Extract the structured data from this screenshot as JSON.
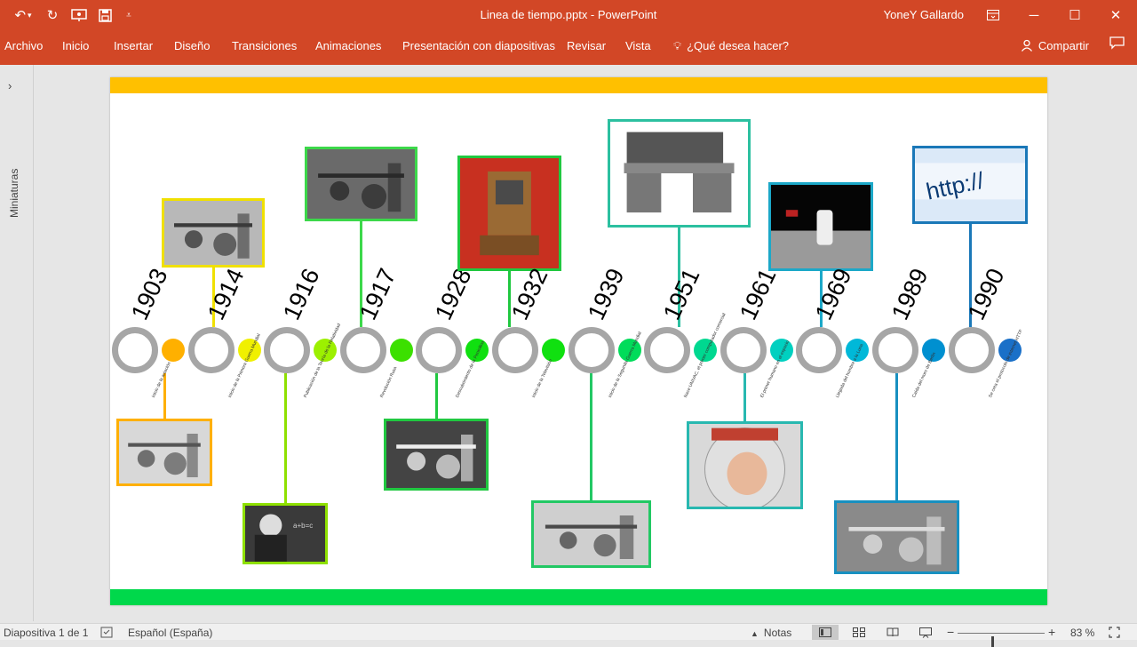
{
  "titlebar": {
    "doc_title": "Linea de tiempo.pptx  -  PowerPoint",
    "user": "YoneY Gallardo",
    "undo_icon": "undo-icon",
    "redo_icon": "redo-icon"
  },
  "ribbon": {
    "tabs": [
      "Archivo",
      "Inicio",
      "Insertar",
      "Diseño",
      "Transiciones",
      "Animaciones",
      "Presentación con diapositivas",
      "Revisar",
      "Vista"
    ],
    "tell_me": "¿Qué desea hacer?",
    "share": "Compartir"
  },
  "thumbnails": {
    "label": "Miniaturas"
  },
  "slide": {
    "colors": {
      "top_bar": "#ffc000",
      "bottom_bar": "#00d84b",
      "ring": "#a6a6a6"
    },
    "events": [
      {
        "year": "1903",
        "dot_color": "#ffb000",
        "caption": "Inicio de la aviación",
        "photo": "early-airplane"
      },
      {
        "year": "1914",
        "dot_color": "#f0f000",
        "caption": "Inicio de la Primera Guerra Mundial",
        "photo": "artillery-cannon"
      },
      {
        "year": "1916",
        "dot_color": "#9cf000",
        "caption": "Publicación de la Teoría de la Relatividad",
        "photo": "einstein-blackboard"
      },
      {
        "year": "1917",
        "dot_color": "#3ce000",
        "caption": "Revolución Rusa",
        "photo": "lenin-crowd"
      },
      {
        "year": "1928",
        "dot_color": "#10e010",
        "caption": "Descubrimiento de la Penicilina",
        "photo": "fleming-lab"
      },
      {
        "year": "1932",
        "dot_color": "#10e010",
        "caption": "Inicio de la Televisión",
        "photo": "early-television"
      },
      {
        "year": "1939",
        "dot_color": "#00dc5a",
        "caption": "Inicio de la Segunda Guerra Mundial",
        "photo": "soldiers-war"
      },
      {
        "year": "1951",
        "dot_color": "#00d890",
        "caption": "Nace UNIVAC, el primer computador comercial",
        "photo": "univac-computer"
      },
      {
        "year": "1961",
        "dot_color": "#00d0c0",
        "caption": "El primer humano en el espacio",
        "photo": "cosmonaut"
      },
      {
        "year": "1969",
        "dot_color": "#00b8d8",
        "caption": "Llegada del hombre a la Luna",
        "photo": "moon-landing"
      },
      {
        "year": "1989",
        "dot_color": "#0090d0",
        "caption": "Caída del muro de Berlín",
        "photo": "berlin-wall"
      },
      {
        "year": "1990",
        "dot_color": "#1a70c8",
        "caption": "Se crea el protocolo de internet HTTP",
        "photo": "http-browser"
      }
    ]
  },
  "statusbar": {
    "slide_info": "Diapositiva 1 de 1",
    "language": "Español (España)",
    "notes": "Notas",
    "zoom": "83 %",
    "zoom_level_fraction": 0.4
  }
}
